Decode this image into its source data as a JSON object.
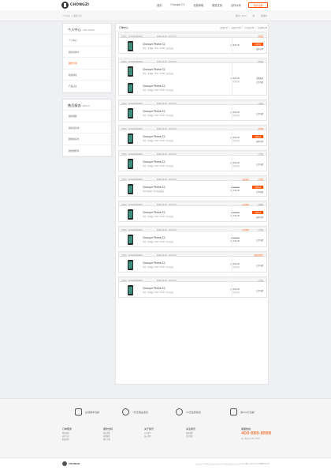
{
  "brand": {
    "name": "CHONGZI"
  },
  "nav": [
    "首页",
    "Chongzi C1",
    "在线商城",
    "服务支持",
    "合作伙伴"
  ],
  "login": "登录/注册",
  "breadcrumb": "个人中心 > 我的订单",
  "subbar_right": [
    "我的 / 12m",
    "搜",
    "购物车"
  ],
  "sidebar": {
    "center": {
      "title": "个人中心",
      "sub": "USER CENTER",
      "items": [
        "个人中心",
        "我的商城卡",
        "我的订单",
        "收货地址",
        "产品认证"
      ]
    },
    "service": {
      "title": "售后服务",
      "sub": "SERVICE",
      "items": [
        "我的保修",
        "我的退货单",
        "我的换货单",
        "我的维修单"
      ]
    }
  },
  "main": {
    "title": "订单中心",
    "filters": [
      "全部订单",
      "未支付订单",
      "已完成订单",
      "已取消订单"
    ]
  },
  "orders": [
    {
      "no": "订单号：1722003649993",
      "date": "2016-11-30　10:07:23",
      "status": "待付款",
      "items": [
        {
          "name": "Chongzi Phone C1",
          "spec": "黑色 / 全网通 / 3GB / 32GB / 官方标配"
        }
      ],
      "price": "￥1699.00",
      "plabel": "",
      "actions": [
        "立即付款",
        "取消订单"
      ]
    },
    {
      "no": "订单号：1722003649993",
      "date": "2016-11-30　10:07:23",
      "status": "待收货",
      "items": [
        {
          "name": "Chongzi Phone C1",
          "spec": "黑色 / 全网通 / 3GB / 32GB / 官方标配"
        },
        {
          "name": "Chongzi Phone C1",
          "spec": "黑色 / 全网通 / 3GB / 32GB / 官方标配"
        }
      ],
      "price": "￥1699.00",
      "plabel": "货到付款",
      "actions": [
        "查看物流",
        "订单详情"
      ]
    },
    {
      "no": "订单号：1722003649993",
      "date": "2016-11-30　10:07:23",
      "status": "已取消",
      "items": [
        {
          "name": "Chongzi Phone C1",
          "spec": "黑色 / 全网通 / 3GB / 32GB / 官方标配"
        }
      ],
      "price": "￥1699.00",
      "plabel": "货到付款",
      "actions": [
        "订单详情"
      ]
    },
    {
      "no": "订单号：1722003649993",
      "date": "2016-11-30　10:07:23",
      "status": "待付款",
      "items": [
        {
          "name": "Chongzi Phone C1",
          "spec": "黑色 / 全网通 / 3GB / 32GB / 官方标配"
        }
      ],
      "price": "￥1699.00",
      "plabel": "货到付款",
      "actions": [
        "立即付款",
        "取消订单"
      ]
    },
    {
      "no": "订单号：1722003649993",
      "date": "2016-11-30　10:07:23",
      "status": "已完成",
      "items": [
        {
          "name": "Chongzi Phone C1",
          "spec": "黑色 / 全网通 / 3GB / 32GB / 官方标配"
        }
      ],
      "price": "￥1699.00",
      "plabel": "货到付款",
      "actions": [
        "订单详情"
      ]
    },
    {
      "no": "订单号：1722003649993",
      "date": "2016-11-30　10:07:23",
      "status": "已付款",
      "extra": "已选支付",
      "items": [
        {
          "name": "Chongzi Phone C1",
          "spec": "黑色/全网通 / 官方标配套装"
        }
      ],
      "orig": "￥1999.00",
      "price": "￥1799.00",
      "plabel": "",
      "actions": [
        "立即付款",
        "订单详情"
      ]
    },
    {
      "no": "订单号：1722003649993",
      "date": "2016-11-30　10:07:23",
      "status": "待收货",
      "extra": "已付款中",
      "items": [
        {
          "name": "Chongzi Phone C1",
          "spec": "黑色 / 全网通 / 3GB / 32GB / 官方标配"
        }
      ],
      "orig": "￥1999.00",
      "price": "￥1799.00",
      "plabel": "",
      "actions": [
        "立即付款",
        "取消订单"
      ]
    },
    {
      "no": "订单号：1722003649993",
      "date": "2016-11-30　10:07:23",
      "status": "已完成",
      "extra": "已付款中",
      "items": [
        {
          "name": "Chongzi Phone C1",
          "spec": "黑色 / 全网通 / 3GB / 32GB / 官方标配"
        }
      ],
      "orig": "￥1999.00",
      "price": "￥1799.00",
      "plabel": "",
      "actions": [
        "订单详情"
      ]
    },
    {
      "no": "订单号：1722003649993",
      "date": "2016-11-30　10:07:23",
      "status": "退款/退货中",
      "items": [
        {
          "name": "Chongzi Phone C1",
          "spec": "黑色 / 全网通 / 3GB / 32GB / 官方标配"
        }
      ],
      "price": "￥1699.00",
      "plabel": "货到付款",
      "actions": [
        "订单详情"
      ]
    },
    {
      "no": "订单号：1722003649993",
      "date": "2016-11-30　10:07:23",
      "status": "已完成",
      "items": [
        {
          "name": "Chongzi Phone C1",
          "spec": "黑色 / 全网通 / 3GB / 32GB / 官方标配"
        }
      ],
      "price": "￥1699.00",
      "plabel": "货到付款",
      "actions": [
        "订单详情"
      ]
    }
  ],
  "services": [
    "全场顺丰包邮",
    "7天无理由退货",
    "15天免费换货",
    "满200元包邮"
  ],
  "footer_cols": [
    {
      "title": "订单服务",
      "links": [
        "购买指南",
        "支付方式",
        "配送说明"
      ]
    },
    {
      "title": "服务支持",
      "links": [
        "售后政策",
        "自助服务",
        "相关下载"
      ]
    },
    {
      "title": "关于我们",
      "links": [
        "公司简介",
        "加入我们"
      ]
    },
    {
      "title": "关注我们",
      "links": [
        "新浪微博",
        "官方微信"
      ]
    }
  ],
  "hotline": {
    "title": "客服热线",
    "number": "400-888-8888",
    "sub": "周一至周日 8:00-18:00"
  },
  "copyright": "Copyright ©2016 Chongzi Tech Co.Ltd All Rights reserved. 沪ICP备XXXXXX号 沪公网安备XXXX号"
}
